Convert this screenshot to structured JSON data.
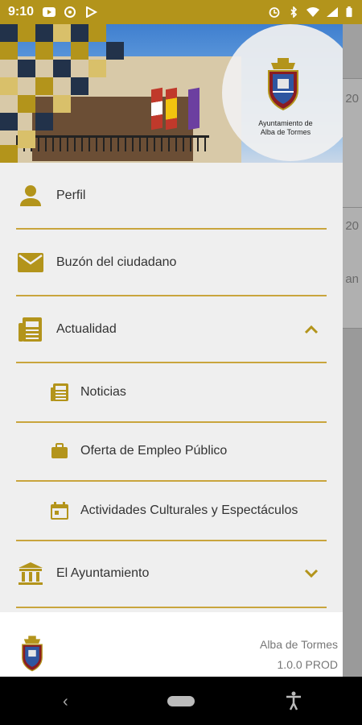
{
  "status_bar": {
    "time": "9:10",
    "left_icons": [
      "youtube-icon",
      "at-icon",
      "play-store-icon"
    ],
    "right_icons": [
      "alarm-icon",
      "bluetooth-icon",
      "wifi-icon",
      "signal-icon",
      "battery-icon"
    ]
  },
  "header": {
    "crest_text_line1": "Ayuntamiento de",
    "crest_text_line2": "Alba de Tormes"
  },
  "background": {
    "card1_text": "20",
    "card2_text": "20",
    "card2_sub": "an"
  },
  "menu": {
    "perfil": "Perfil",
    "buzon": "Buzón del ciudadano",
    "actualidad": "Actualidad",
    "noticias": "Noticias",
    "empleo": "Oferta de Empleo Público",
    "actividades": "Actividades Culturales y Espectáculos",
    "ayuntamiento": "El Ayuntamiento"
  },
  "footer": {
    "name": "Alba de Tormes",
    "version": "1.0.0 PROD"
  },
  "colors": {
    "accent": "#b3941b",
    "divider": "#c9a53d",
    "icon": "#b3941b"
  }
}
